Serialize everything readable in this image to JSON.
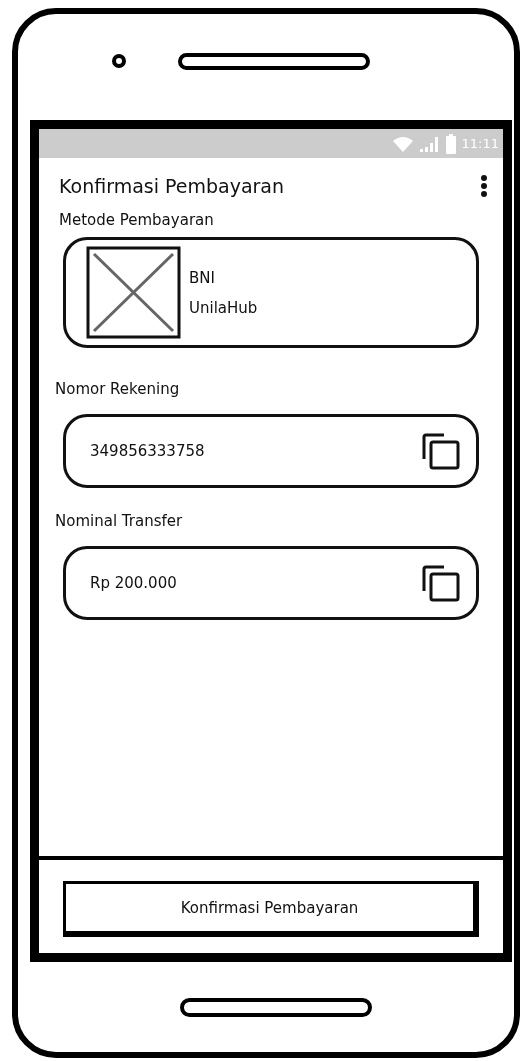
{
  "status_bar": {
    "time": "11:11"
  },
  "app_bar": {
    "title": "Konfirmasi Pembayaran"
  },
  "payment_method": {
    "label": "Metode Pembayaran",
    "bank": "BNI",
    "account_name": "UnilaHub"
  },
  "fields": [
    {
      "label": "Nomor Rekening",
      "value": "349856333758"
    },
    {
      "label": "Nominal Transfer",
      "value": "Rp 200.000"
    }
  ],
  "button": {
    "label": "Konfirmasi Pembayaran"
  }
}
